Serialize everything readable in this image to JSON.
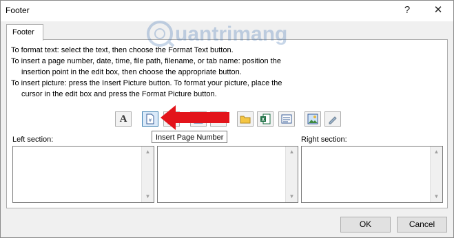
{
  "window": {
    "title": "Footer",
    "help_glyph": "?",
    "close_glyph": "✕"
  },
  "tab": {
    "label": "Footer"
  },
  "instructions": [
    "To format text:  select the text, then choose the Format Text button.",
    "To insert a page number, date, time, file path, filename, or tab name:  position the",
    "insertion point in the edit box, then choose the appropriate button.",
    "To insert picture: press the Insert Picture button.  To format your picture, place the",
    "cursor in the edit box and press the Format Picture button."
  ],
  "toolbar": {
    "format_text_glyph": "A",
    "buttons": [
      "format-text",
      "insert-page-number",
      "insert-number-of-pages",
      "insert-date",
      "insert-time",
      "insert-file-path",
      "insert-file-name",
      "insert-sheet-name",
      "insert-picture",
      "format-picture"
    ]
  },
  "tooltip": "Insert Page Number",
  "sections": {
    "left_label": "Left section:",
    "right_label": "Right section:",
    "left_value": "",
    "center_value": "",
    "right_value": ""
  },
  "buttons": {
    "ok": "OK",
    "cancel": "Cancel"
  },
  "watermark": {
    "text": "uantrimang"
  },
  "colors": {
    "arrow": "#e3141b",
    "accent_border": "#3c7fb1"
  }
}
